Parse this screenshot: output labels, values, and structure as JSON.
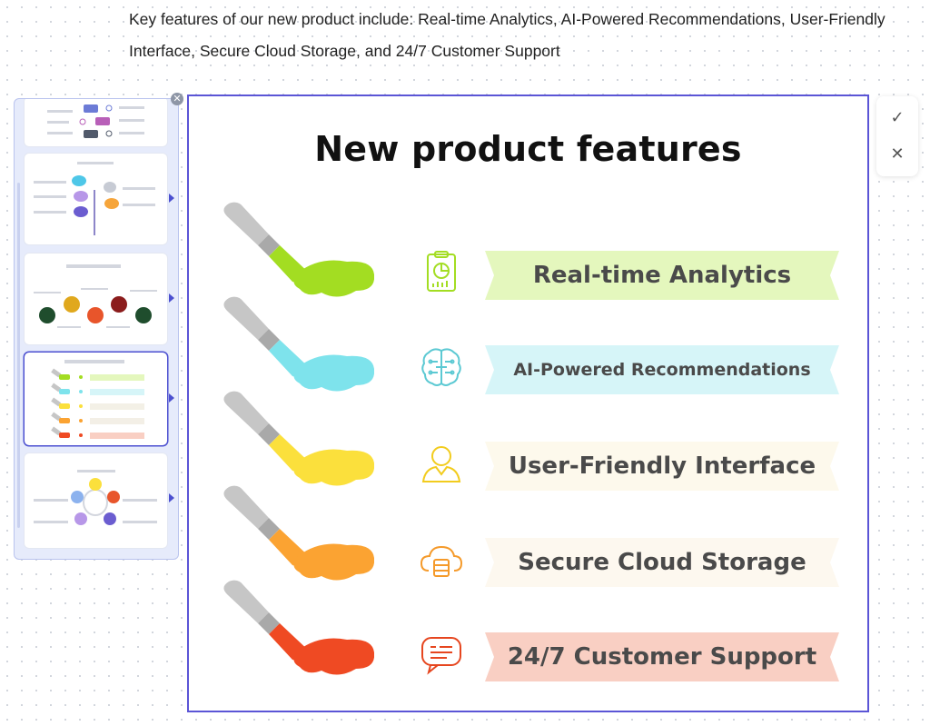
{
  "prompt": {
    "text": "Key features of our new product include: Real-time Analytics, AI-Powered Recommendations, User-Friendly Interface, Secure Cloud Storage, and 24/7 Customer Support"
  },
  "thumbnail_panel": {
    "close_icon": "close-icon",
    "selected_index": 3,
    "count": 5
  },
  "slide": {
    "title": "New product features",
    "features": [
      {
        "label": "Real-time Analytics",
        "icon": "analytics-clipboard-icon",
        "color": "#a3dd22",
        "ribbon": "#e4f7bd"
      },
      {
        "label": "AI-Powered Recommendations",
        "icon": "brain-circuit-icon",
        "color": "#7ee3ec",
        "ribbon": "#d6f5f8"
      },
      {
        "label": "User-Friendly Interface",
        "icon": "user-icon",
        "color": "#fbe03c",
        "ribbon": "#fdf9ec"
      },
      {
        "label": "Secure Cloud Storage",
        "icon": "cloud-storage-icon",
        "color": "#fba332",
        "ribbon": "#fdf8ef"
      },
      {
        "label": "24/7 Customer Support",
        "icon": "chat-support-icon",
        "color": "#ef4a23",
        "ribbon": "#f9cfc3"
      }
    ]
  },
  "actions": {
    "accept_icon": "checkmark-icon",
    "reject_icon": "close-icon"
  }
}
